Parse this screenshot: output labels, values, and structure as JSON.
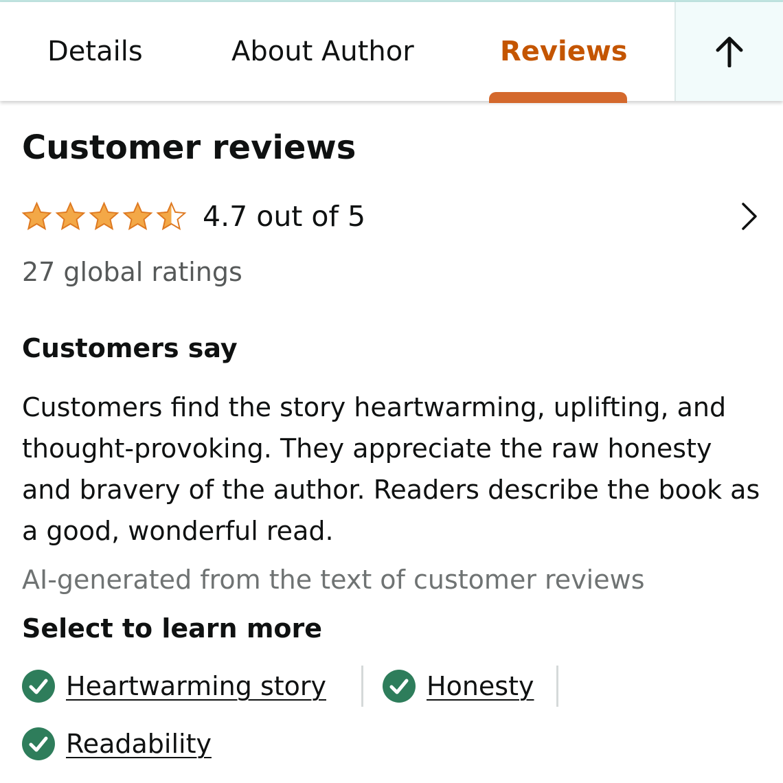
{
  "tabs": [
    {
      "label": "Details",
      "active": false
    },
    {
      "label": "About Author",
      "active": false
    },
    {
      "label": "Reviews",
      "active": true
    }
  ],
  "colors": {
    "active_tab": "#c45500",
    "active_underline": "#d4692d",
    "star_fill": "#f3a847",
    "star_stroke": "#de7921",
    "check_bg": "#2e7d5b",
    "muted_text": "#565959"
  },
  "icons": {
    "back_to_top": "arrow-up-icon",
    "rating_detail": "chevron-right-icon",
    "star": "star-icon",
    "chip": "check-circle-icon"
  },
  "reviews": {
    "title": "Customer reviews",
    "rating": {
      "value": 4.7,
      "out_of": 5,
      "text": "4.7 out of 5",
      "stars_filled": 4.5
    },
    "global_ratings": "27 global ratings",
    "customers_say": {
      "heading": "Customers say",
      "summary": "Customers find the story heartwarming, uplifting, and thought-provoking. They appreciate the raw honesty and bravery of the author. Readers describe the book as a good, wonderful read.",
      "ai_note": "AI-generated from the text of customer reviews"
    },
    "select_heading": "Select to learn more",
    "aspects": [
      {
        "label": "Heartwarming story"
      },
      {
        "label": "Honesty"
      },
      {
        "label": "Readability"
      }
    ]
  }
}
